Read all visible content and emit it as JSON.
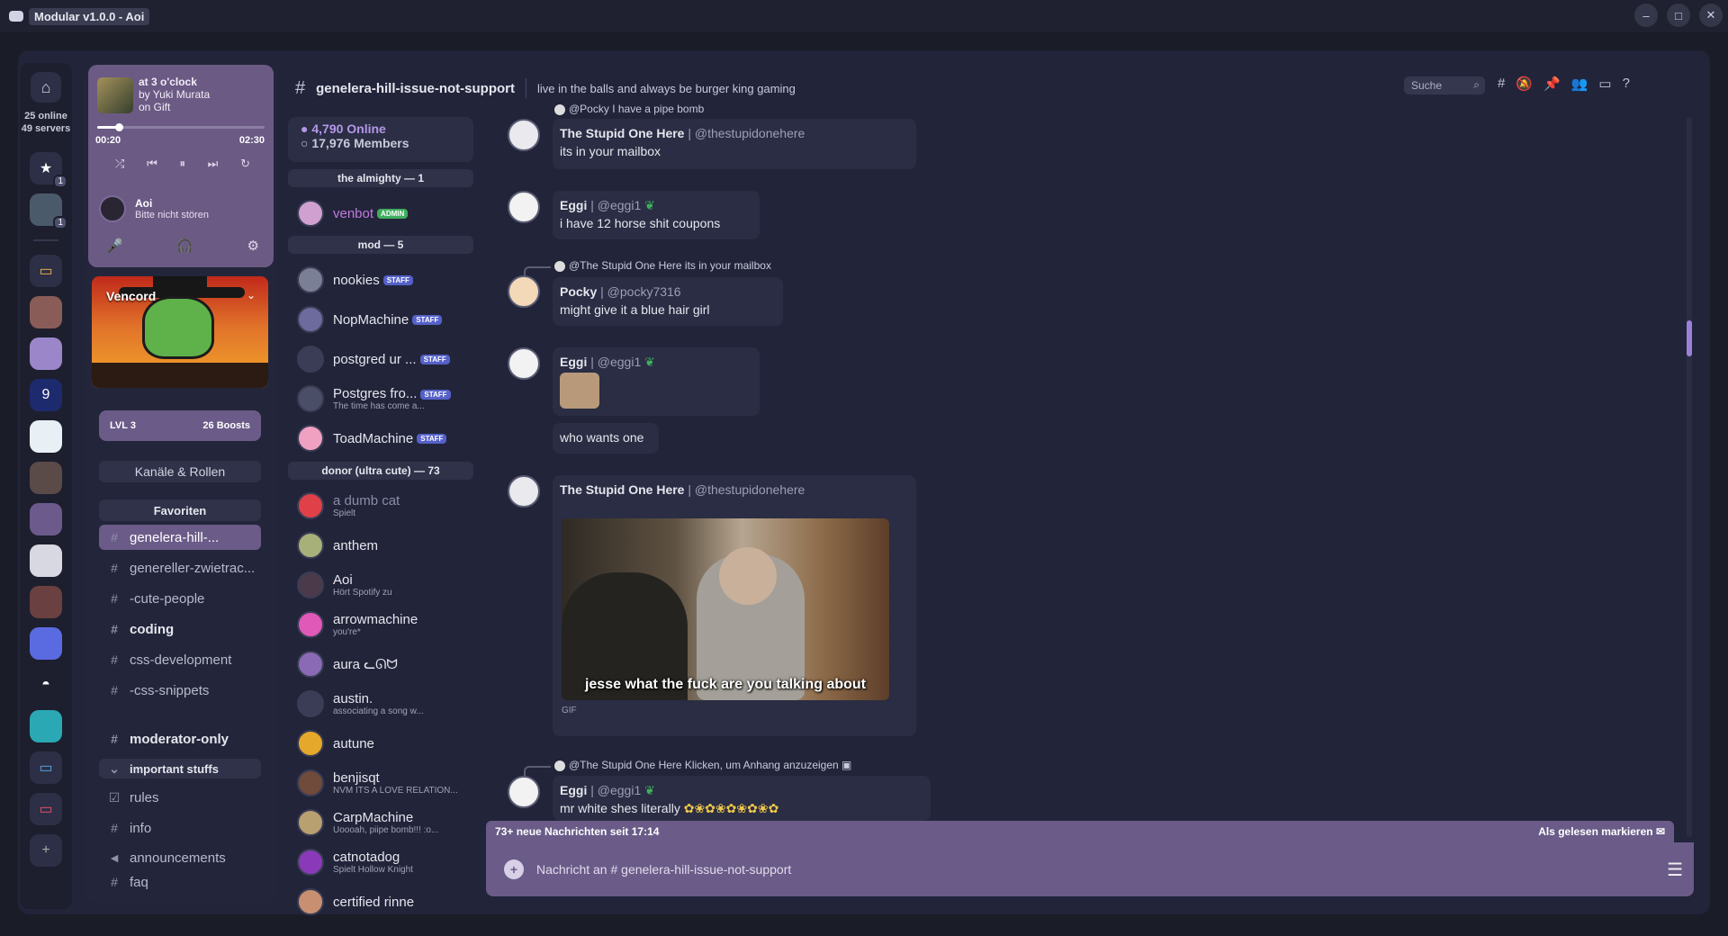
{
  "window": {
    "title": "Modular v1.0.0 - Aoi"
  },
  "rail": {
    "online": "25 online",
    "servers": "49 servers",
    "badges": [
      "1",
      "1"
    ]
  },
  "player": {
    "track": "at 3 o'clock",
    "artist": "by Yuki Murata",
    "album": "on Gift",
    "elapsed": "00:20",
    "duration": "02:30",
    "progress": 0.13
  },
  "user": {
    "name": "Aoi",
    "status": "Bitte nicht stören"
  },
  "server": {
    "name": "Vencord",
    "level": "LVL 3",
    "boosts": "26 Boosts"
  },
  "sidebar": {
    "roles_button": "Kanäle & Rollen",
    "favorites": "Favoriten",
    "channels": [
      {
        "name": "genelera-hill-...",
        "active": true
      },
      {
        "name": "genereller-zwietrac..."
      },
      {
        "name": "-cute-people"
      },
      {
        "name": "coding",
        "bold": true
      },
      {
        "name": "css-development"
      },
      {
        "name": "-css-snippets"
      },
      {
        "name": "moderator-only",
        "bold": true
      },
      {
        "name": "important stuffs",
        "category": true
      },
      {
        "name": "rules"
      },
      {
        "name": "info"
      },
      {
        "name": "announcements"
      },
      {
        "name": "faq"
      }
    ]
  },
  "members": {
    "online": "4,790 Online",
    "total": "17,976 Members",
    "groups": [
      "the almighty — 1",
      "mod — 5",
      "donor (ultra cute) — 73"
    ],
    "list": [
      {
        "name": "venbot",
        "tag": "ADMIN",
        "sub": ""
      },
      {
        "name": "nookies",
        "tag": "STAFF",
        "sub": ""
      },
      {
        "name": "NopMachine",
        "tag": "STAFF",
        "sub": ""
      },
      {
        "name": "postgred ur ...",
        "tag": "STAFF",
        "sub": ""
      },
      {
        "name": "Postgres fro...",
        "tag": "STAFF",
        "sub": "The time has come a..."
      },
      {
        "name": "ToadMachine",
        "tag": "STAFF",
        "sub": ""
      },
      {
        "name": "a dumb cat",
        "tag": "",
        "sub": "Spielt"
      },
      {
        "name": "anthem",
        "tag": "",
        "sub": ""
      },
      {
        "name": "Aoi",
        "tag": "",
        "sub": "Hört Spotify zu"
      },
      {
        "name": "arrowmachine",
        "tag": "",
        "sub": "you're*"
      },
      {
        "name": "aura ᓚᘏᗢ",
        "tag": "",
        "sub": ""
      },
      {
        "name": "austin.",
        "tag": "",
        "sub": "associating a song w..."
      },
      {
        "name": "autune",
        "tag": "",
        "sub": ""
      },
      {
        "name": "benjisqt",
        "tag": "",
        "sub": "NVM ITS A LOVE RELATION..."
      },
      {
        "name": "CarpMachine",
        "tag": "",
        "sub": "Uoooah, piipe bomb!!! :o..."
      },
      {
        "name": "catnotadog",
        "tag": "",
        "sub": "Spielt Hollow Knight"
      },
      {
        "name": "certified rinne",
        "tag": "",
        "sub": ""
      }
    ]
  },
  "chat": {
    "channel": "genelera-hill-issue-not-support",
    "topic": "live in the balls and always be burger king gaming",
    "search_placeholder": "Suche",
    "top_reply": "@Pocky I have a pipe bomb",
    "messages": [
      {
        "author": "The Stupid One Here",
        "handle": "| @thestupidonehere",
        "text": "its in your mailbox"
      },
      {
        "author": "Eggi",
        "handle": "| @eggi1",
        "text": "i have 12 horse shit coupons"
      },
      {
        "reply": "@The Stupid One Here its in your mailbox",
        "author": "Pocky",
        "handle": "| @pocky7316",
        "text": "might give it a blue hair girl"
      },
      {
        "author": "Eggi",
        "handle": "| @eggi1",
        "text": ""
      },
      {
        "author": "",
        "handle": "",
        "text": "who wants one"
      },
      {
        "author": "The Stupid One Here",
        "handle": "| @thestupidonehere",
        "text": ""
      },
      {
        "reply": "@The Stupid One Here Klicken, um Anhang anzuzeigen",
        "author": "Eggi",
        "handle": "| @eggi1",
        "text": "mr white shes literally"
      }
    ],
    "gif_caption": "jesse what the fuck are you talking about",
    "gif_label": "GIF",
    "new_messages": "73+ neue Nachrichten seit 17:14",
    "mark_read": "Als gelesen markieren",
    "composer_placeholder": "Nachricht an # genelera-hill-issue-not-support"
  }
}
